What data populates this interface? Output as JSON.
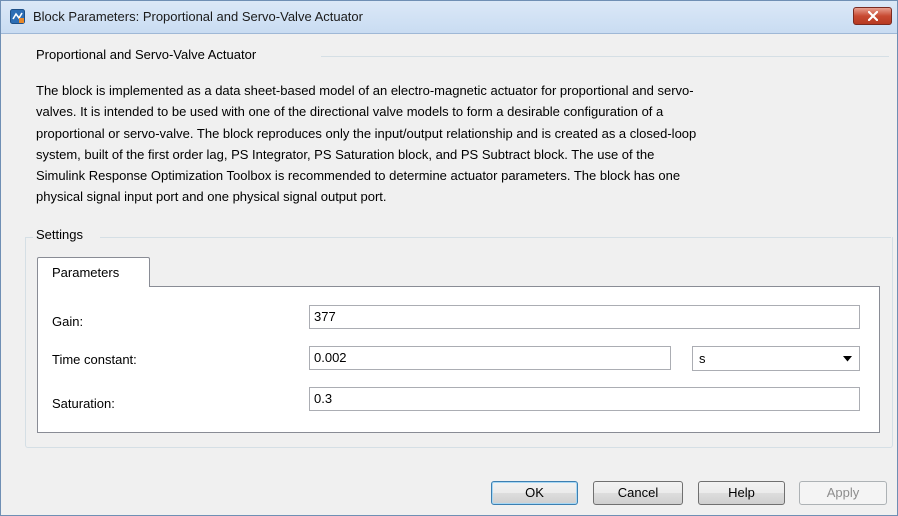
{
  "window": {
    "title": "Block Parameters: Proportional and Servo-Valve Actuator",
    "app_icon": "simulink-block-icon",
    "close_icon": "close-icon"
  },
  "description_group": {
    "header": "Proportional and Servo-Valve Actuator",
    "lines": [
      "The block is implemented as a data sheet-based model of an electro-magnetic actuator for proportional and servo-",
      "valves. It is intended to be used with one of the directional valve models to form a desirable configuration of a",
      "proportional or servo-valve. The block reproduces only the input/output relationship and is created as a closed-loop",
      "system, built of the first order lag, PS Integrator, PS Saturation block, and PS Subtract block. The use of the",
      "Simulink Response Optimization Toolbox is recommended to determine actuator parameters. The block has one",
      "physical signal input port and one physical signal output port."
    ]
  },
  "settings": {
    "header": "Settings",
    "tabs": [
      {
        "label": "Parameters"
      }
    ],
    "params": [
      {
        "label": "Gain:",
        "value": "377"
      },
      {
        "label": "Time constant:",
        "value": "0.002",
        "unit": "s"
      },
      {
        "label": "Saturation:",
        "value": "0.3"
      }
    ]
  },
  "buttons": {
    "ok": "OK",
    "cancel": "Cancel",
    "help": "Help",
    "apply": "Apply"
  },
  "colors": {
    "title_bar": "#c9dcf2",
    "close_button": "#c84a32",
    "dialog_background": "#f0f0f0",
    "default_button_border": "#3c7fb1"
  }
}
